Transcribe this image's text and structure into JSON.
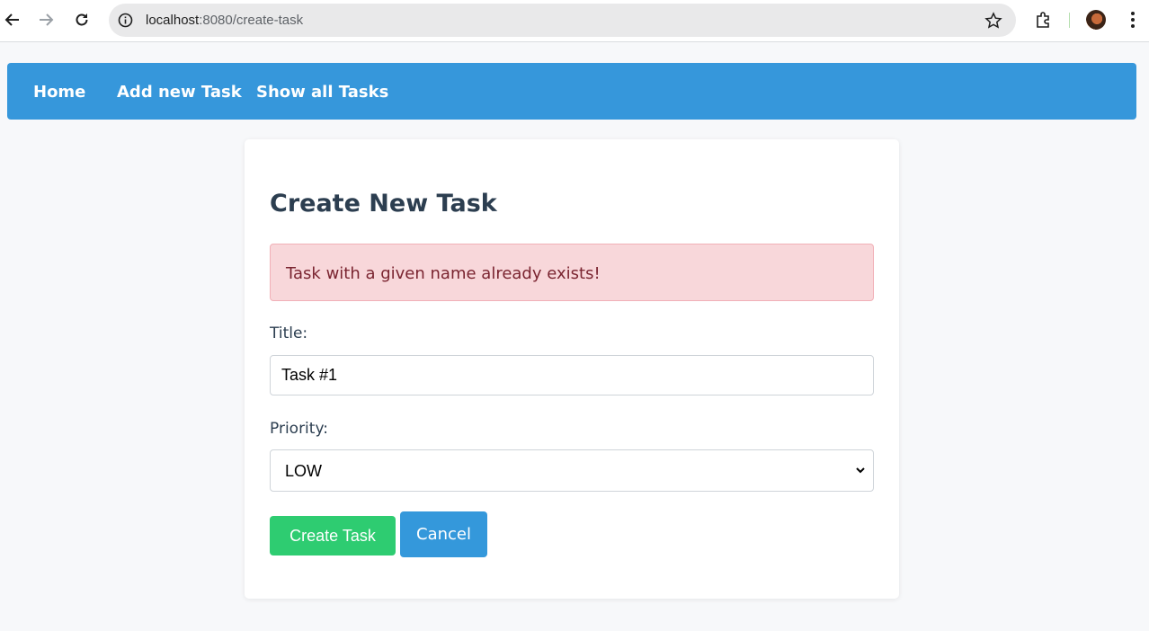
{
  "browser": {
    "url_host": "localhost",
    "url_path": ":8080/create-task"
  },
  "navbar": {
    "items": [
      {
        "label": "Home"
      },
      {
        "label": "Add new Task"
      },
      {
        "label": "Show all Tasks"
      }
    ],
    "color": "#3697db"
  },
  "form": {
    "title": "Create New Task",
    "error": "Task with a given name already exists!",
    "title_label": "Title:",
    "title_value": "Task #1",
    "priority_label": "Priority:",
    "priority_value": "LOW",
    "create_label": "Create Task",
    "cancel_label": "Cancel"
  },
  "colors": {
    "create_button": "#2ecc71",
    "cancel_button": "#3498db",
    "error_bg": "#f8d7da"
  }
}
